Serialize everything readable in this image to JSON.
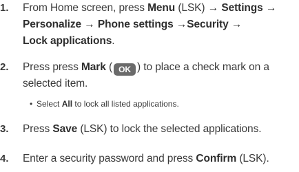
{
  "steps": [
    {
      "number": "1.",
      "lines": [
        {
          "prefix": "From Home screen, press ",
          "bold1": "Menu",
          "mid1": " (LSK) ",
          "arrow1": "→",
          "sp1": " ",
          "bold2": "Settings",
          "sp2": " ",
          "arrow2": "→"
        },
        {
          "bold1": "Personalize",
          "sp1": " ",
          "arrow1": "→",
          "sp2": " ",
          "bold2": "Phone settings",
          "sp3": " ",
          "arrow2": "→",
          "bold3": "Security",
          "sp4": " ",
          "arrow3": "→"
        },
        {
          "bold1": "Lock applications",
          "suffix": "."
        }
      ]
    },
    {
      "number": "2.",
      "line1_prefix": "Press press ",
      "line1_bold": "Mark",
      "line1_open": " (",
      "ok_key": "OK",
      "line1_close": ") to place a check mark on a",
      "line2": "selected item."
    },
    {
      "bullet": "•",
      "prefix": "Select ",
      "bold": "All",
      "suffix": " to lock all listed applications."
    },
    {
      "number": "3.",
      "prefix": "Press ",
      "bold": "Save",
      "suffix": " (LSK) to lock the selected applications."
    },
    {
      "number": "4.",
      "prefix": "Enter a security password and press ",
      "bold": "Confirm",
      "suffix": " (LSK)."
    }
  ]
}
